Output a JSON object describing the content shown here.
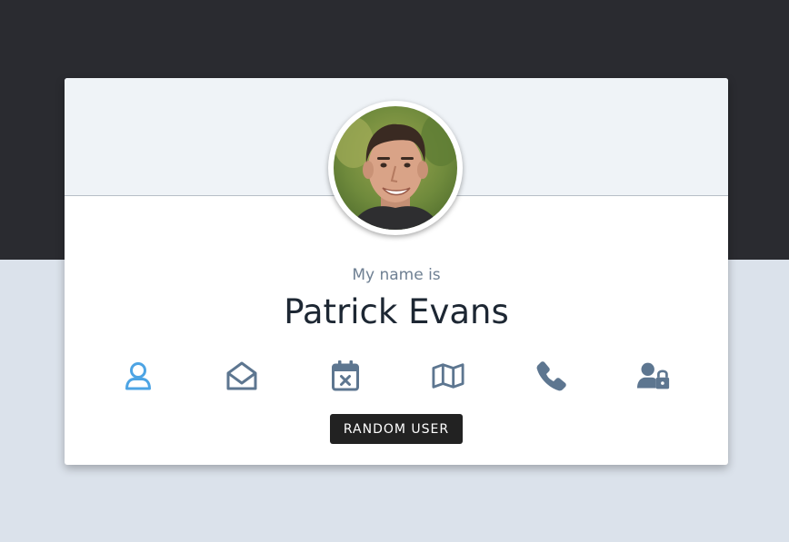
{
  "card": {
    "subtitle": "My name is",
    "name": "Patrick Evans",
    "button_label": "RANDOM USER"
  },
  "icons": [
    {
      "name": "user-icon",
      "active": true
    },
    {
      "name": "envelope-open-icon",
      "active": false
    },
    {
      "name": "calendar-icon",
      "active": false
    },
    {
      "name": "map-icon",
      "active": false
    },
    {
      "name": "phone-icon",
      "active": false
    },
    {
      "name": "user-lock-icon",
      "active": false
    }
  ],
  "colors": {
    "dark_bg": "#2a2b30",
    "light_bg": "#dbe2eb",
    "icon_default": "#5d7690",
    "icon_active": "#4da4e4",
    "button_bg": "#222222"
  }
}
